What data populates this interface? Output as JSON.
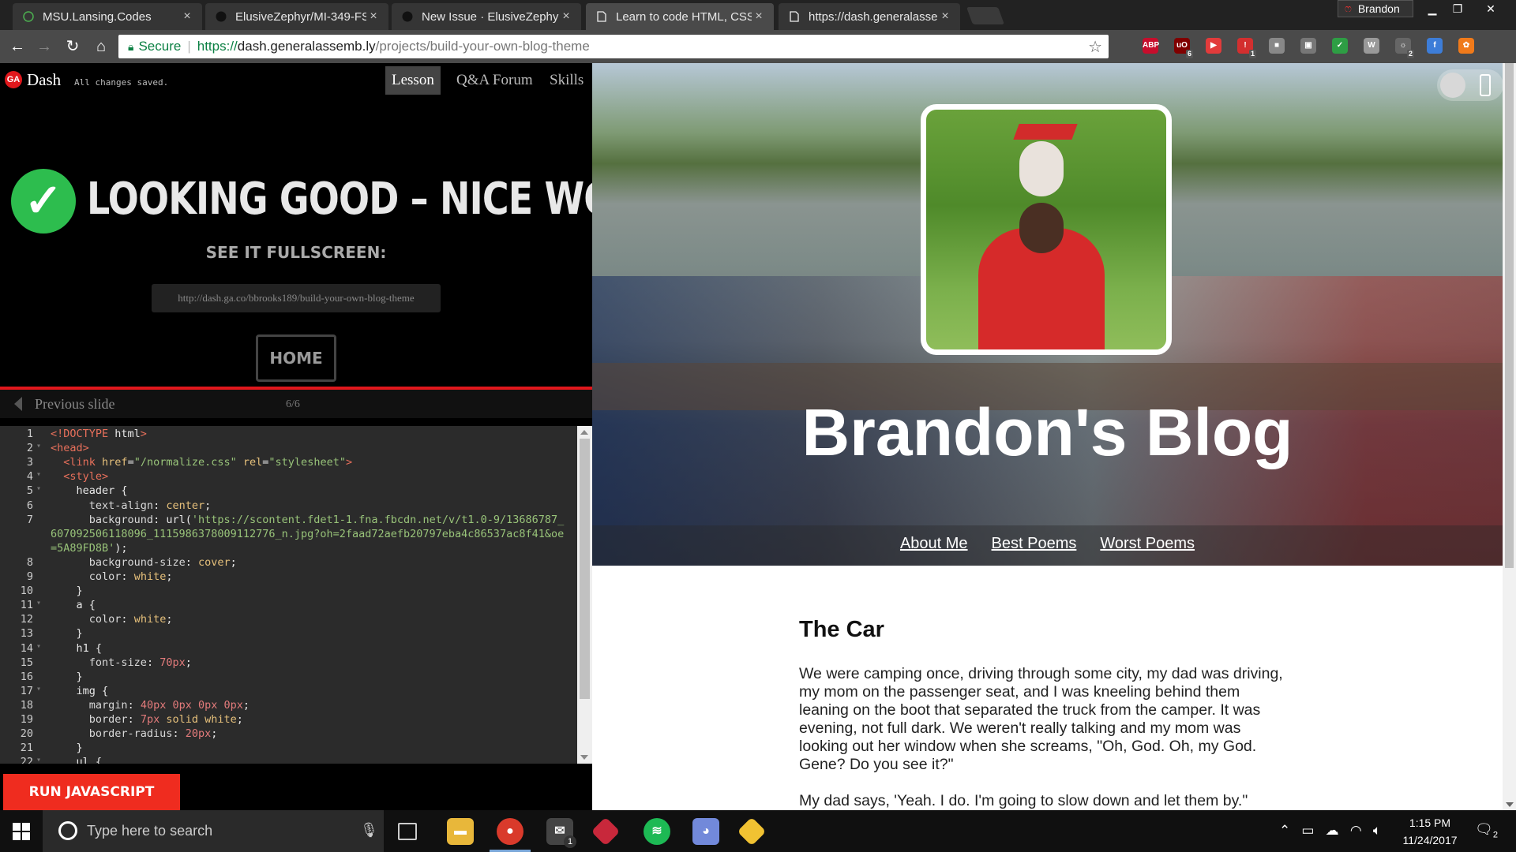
{
  "tabs": [
    {
      "title": "MSU.Lansing.Codes",
      "active": false
    },
    {
      "title": "ElusiveZephyr/MI-349-FS",
      "active": false
    },
    {
      "title": "New Issue · ElusiveZephy",
      "active": false
    },
    {
      "title": "Learn to code HTML, CSS",
      "active": true
    },
    {
      "title": "https://dash.generalasse",
      "active": false
    }
  ],
  "profile": {
    "name": "Brandon"
  },
  "omnibox": {
    "secure_label": "Secure",
    "url_scheme": "https://",
    "url_host": "dash.generalassemb.ly",
    "url_path": "/projects/build-your-own-blog-theme"
  },
  "extensions": [
    {
      "name": "adblock-plus-icon",
      "label": "ABP",
      "color": "#c70d2c"
    },
    {
      "name": "ublock-icon",
      "label": "uO",
      "color": "#800000",
      "badge": "6"
    },
    {
      "name": "video-icon",
      "label": "▶",
      "color": "#e23b3b"
    },
    {
      "name": "alert-extension-icon",
      "label": "!",
      "color": "#d32f2f",
      "badge": "1"
    },
    {
      "name": "gray-extension-icon",
      "label": "■",
      "color": "#888888"
    },
    {
      "name": "screenshot-icon",
      "label": "▣",
      "color": "#777777"
    },
    {
      "name": "check-extension-icon",
      "label": "✓",
      "color": "#2e9e44"
    },
    {
      "name": "w-extension-icon",
      "label": "W",
      "color": "#999999"
    },
    {
      "name": "weather-extension-icon",
      "label": "☼",
      "color": "#666666",
      "badge": "2"
    },
    {
      "name": "feather-extension-icon",
      "label": "f",
      "color": "#3d7dd8"
    },
    {
      "name": "orange-extension-icon",
      "label": "✿",
      "color": "#f07a1a"
    }
  ],
  "dash": {
    "logo": "GA",
    "title": "Dash",
    "saved_status": "All changes saved.",
    "tabs": [
      "Lesson",
      "Q&A Forum",
      "Skills"
    ],
    "active_tab": "Lesson"
  },
  "lesson": {
    "headline": "LOOKING GOOD – NICE WORK!",
    "see_fullscreen": "SEE IT FULLSCREEN:",
    "share_url": "http://dash.ga.co/bbrooks189/build-your-own-blog-theme",
    "home_label": "HOME",
    "prev_label": "Previous slide",
    "slide_count": "6/6",
    "run_label": "RUN JAVASCRIPT"
  },
  "code_lines": [
    {
      "n": "1",
      "fold": "",
      "html": "<span class='tag'>&lt;!DOCTYPE</span> html<span class='tag'>&gt;</span>"
    },
    {
      "n": "2",
      "fold": "▾",
      "html": "<span class='tag'>&lt;head&gt;</span>"
    },
    {
      "n": "3",
      "fold": "",
      "html": "  <span class='tag'>&lt;link</span> <span class='attr'>href</span>=<span class='str'>\"/normalize.css\"</span> <span class='attr'>rel</span>=<span class='str'>\"stylesheet\"</span><span class='tag'>&gt;</span>"
    },
    {
      "n": "4",
      "fold": "▾",
      "html": "  <span class='tag'>&lt;style&gt;</span>"
    },
    {
      "n": "5",
      "fold": "▾",
      "html": "    header {"
    },
    {
      "n": "6",
      "fold": "",
      "html": "      <span class='prop'>text-align</span>: <span class='attr'>center</span>;"
    },
    {
      "n": "7",
      "fold": "",
      "html": "      <span class='prop'>background</span>: url(<span class='str'>'https://scontent.fdet1-1.fna.fbcdn.net/v/t1.0-9/13686787_</span>"
    },
    {
      "n": "",
      "fold": "",
      "html": "<span class='str'>607092506118096_1115986378009112776_n.jpg?oh=2faad72aefb20797eba4c86537ac8f41&amp;oe</span>"
    },
    {
      "n": "",
      "fold": "",
      "html": "<span class='str'>=5A89FD8B'</span>);"
    },
    {
      "n": "8",
      "fold": "",
      "html": "      <span class='prop'>background-size</span>: <span class='attr'>cover</span>;"
    },
    {
      "n": "9",
      "fold": "",
      "html": "      <span class='prop'>color</span>: <span class='attr'>white</span>;"
    },
    {
      "n": "10",
      "fold": "",
      "html": "    }"
    },
    {
      "n": "11",
      "fold": "▾",
      "html": "    a {"
    },
    {
      "n": "12",
      "fold": "",
      "html": "      <span class='prop'>color</span>: <span class='attr'>white</span>;"
    },
    {
      "n": "13",
      "fold": "",
      "html": "    }"
    },
    {
      "n": "14",
      "fold": "▾",
      "html": "    h1 {"
    },
    {
      "n": "15",
      "fold": "",
      "html": "      <span class='prop'>font-size</span>: <span class='num'>70px</span>;"
    },
    {
      "n": "16",
      "fold": "",
      "html": "    }"
    },
    {
      "n": "17",
      "fold": "▾",
      "html": "    img {"
    },
    {
      "n": "18",
      "fold": "",
      "html": "      <span class='prop'>margin</span>: <span class='num'>40px 0px 0px 0px</span>;"
    },
    {
      "n": "19",
      "fold": "",
      "html": "      <span class='prop'>border</span>: <span class='num'>7px</span> <span class='attr'>solid white</span>;"
    },
    {
      "n": "20",
      "fold": "",
      "html": "      <span class='prop'>border-radius</span>: <span class='num'>20px</span>;"
    },
    {
      "n": "21",
      "fold": "",
      "html": "    }"
    },
    {
      "n": "22",
      "fold": "▾",
      "html": "    ul {"
    }
  ],
  "blog": {
    "title": "Brandon's Blog",
    "nav": [
      "About Me",
      "Best Poems",
      "Worst Poems"
    ],
    "post_title": "The Car",
    "paragraphs": [
      "We were camping once, driving through some city, my dad was driving, my mom on the passenger seat, and I was kneeling behind them leaning on the boot that separated the truck from the camper. It was evening, not full dark. We weren't really talking and my mom was looking out her window when she screams, \"Oh, God. Oh, my God. Gene? Do you see it?\"",
      "My dad says, 'Yeah. I do. I'm going to slow down and let them by.\""
    ]
  },
  "taskbar": {
    "search_placeholder": "Type here to search",
    "time": "1:15 PM",
    "date": "11/24/2017",
    "notification_count": "2",
    "mail_badge": "1"
  }
}
